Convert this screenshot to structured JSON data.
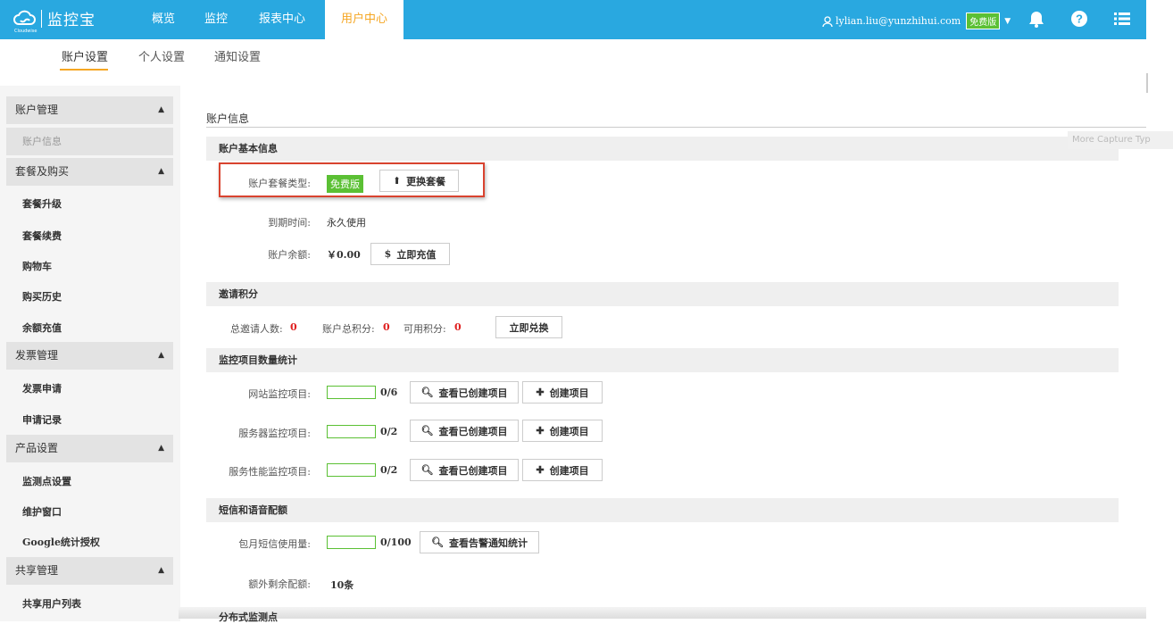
{
  "topbar": {
    "logo_text": "监控宝",
    "logo_sub": "Cloudwise",
    "nav": [
      "概览",
      "监控",
      "报表中心",
      "用户中心"
    ],
    "active_nav": "用户中心",
    "user_email": "lylian.liu@yunzhihui.com",
    "plan_badge": "免费版",
    "icons": [
      "bell-icon",
      "help-icon",
      "menu-list-icon"
    ]
  },
  "subnav": {
    "tabs": [
      "账户设置",
      "个人设置",
      "通知设置"
    ],
    "active": "账户设置"
  },
  "sidebar": {
    "groups": [
      {
        "title": "账户管理",
        "items": [
          "账户信息"
        ]
      },
      {
        "title": "套餐及购买",
        "items": [
          "套餐升级",
          "套餐续费",
          "购物车",
          "购买历史",
          "余额充值"
        ]
      },
      {
        "title": "发票管理",
        "items": [
          "发票申请",
          "申请记录"
        ]
      },
      {
        "title": "产品设置",
        "items": [
          "监测点设置",
          "维护窗口",
          "Google统计授权"
        ]
      },
      {
        "title": "共享管理",
        "items": [
          "共享用户列表"
        ]
      }
    ],
    "current": "账户信息"
  },
  "main": {
    "title": "账户信息",
    "basic": {
      "header": "账户基本信息",
      "plan_label": "账户套餐类型:",
      "plan_value": "免费版",
      "change_plan_btn": "更换套餐",
      "expire_label": "到期时间:",
      "expire_value": "永久使用",
      "balance_label": "账户余额:",
      "balance_value": "￥0.00",
      "recharge_btn": "立即充值"
    },
    "invite": {
      "header": "邀请积分",
      "invited_label": "总邀请人数:",
      "invited_value": "0",
      "total_points_label": "账户总积分:",
      "total_points_value": "0",
      "available_label": "可用积分:",
      "available_value": "0",
      "redeem_btn": "立即兑换"
    },
    "monitor": {
      "header": "监控项目数量统计",
      "rows": [
        {
          "label": "网站监控项目:",
          "count": "0/6",
          "fraction": 0,
          "view_btn": "查看已创建项目",
          "create_btn": "创建项目"
        },
        {
          "label": "服务器监控项目:",
          "count": "0/2",
          "fraction": 0,
          "view_btn": "查看已创建项目",
          "create_btn": "创建项目"
        },
        {
          "label": "服务性能监控项目:",
          "count": "0/2",
          "fraction": 0,
          "view_btn": "查看已创建项目",
          "create_btn": "创建项目"
        }
      ]
    },
    "sms": {
      "header": "短信和语音配额",
      "monthly_label": "包月短信使用量:",
      "monthly_count": "0/100",
      "monthly_fraction": 0,
      "view_stats_btn": "查看告警通知统计",
      "extra_label": "额外剩余配额:",
      "extra_value": "10条"
    },
    "next_section": "分布式监测点"
  },
  "overlay": {
    "capture_hint": "More Capture Typ"
  },
  "colors": {
    "topbar": "#29a8e0",
    "accent": "#f5a623",
    "badge_green": "#5bc034",
    "highlight_red": "#d9432f"
  }
}
